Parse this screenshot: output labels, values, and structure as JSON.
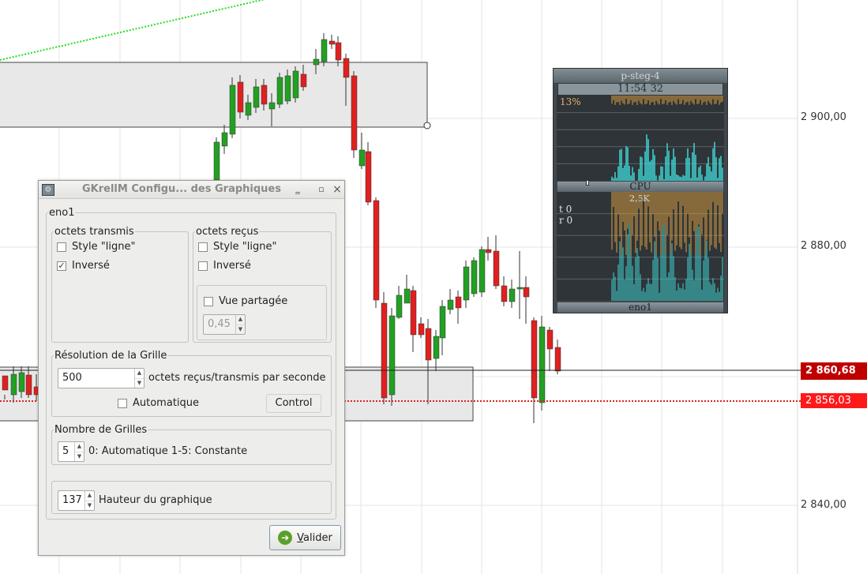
{
  "chart": {
    "price_labels": [
      "2 900,00",
      "2 880,00",
      "2 840,00"
    ],
    "current_price": "2 860,68",
    "current_price_color": "#c00000",
    "marker_price": "2 856,03",
    "marker_price_color": "#ff1a1a",
    "bull_color": "#22a022",
    "bear_color": "#e02020"
  },
  "dialog": {
    "title": "GKrellM Configu... des Graphiques",
    "minimize": "‗",
    "maximize": "▫",
    "close": "×",
    "interface_group": "eno1",
    "sent": {
      "legend": "octets transmis",
      "line_style_label": "Style \"ligne\"",
      "line_style_checked": false,
      "inverse_label": "Inversé",
      "inverse_checked": true
    },
    "received": {
      "legend": "octets reçus",
      "line_style_label": "Style \"ligne\"",
      "line_style_checked": false,
      "inverse_label": "Inversé",
      "inverse_checked": false,
      "split_view_label": "Vue partagée",
      "split_view_checked": false,
      "split_ratio": "0,45"
    },
    "grid_resolution": {
      "legend": "Résolution de la Grille",
      "value": "500",
      "unit_label": "octets reçus/transmis par seconde",
      "auto_label": "Automatique",
      "auto_checked": false,
      "control_button": "Control"
    },
    "grid_count": {
      "legend": "Nombre de Grilles",
      "value": "5",
      "hint": "0: Automatique 1-5: Constante"
    },
    "height": {
      "value": "137",
      "label": "Hauteur du graphique"
    },
    "ok_button_accel": "V",
    "ok_button_rest": "alider"
  },
  "gkrellm": {
    "hostname": "p-steg-4",
    "clock": "11:54 32",
    "cpu_percent": "13%",
    "cpu_label": "CPU",
    "net_rate": "2,5K",
    "tx_label": "t 0",
    "rx_label": "r 0",
    "net_label": "eno1",
    "cpu_color": "#3fd6d6",
    "load_color": "#e0a040"
  }
}
